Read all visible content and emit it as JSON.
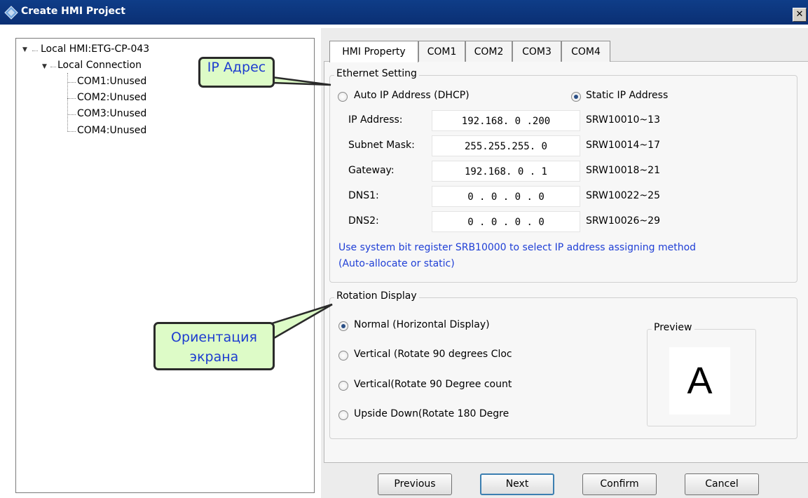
{
  "window": {
    "title": "Create HMI Project",
    "close_glyph": "✕"
  },
  "tree": {
    "root": "Local HMI:ETG-CP-043",
    "connection": "Local Connection",
    "items": [
      "COM1:Unused",
      "COM2:Unused",
      "COM3:Unused",
      "COM4:Unused"
    ]
  },
  "tabs": [
    "HMI Property",
    "COM1",
    "COM2",
    "COM3",
    "COM4"
  ],
  "ethernet": {
    "group_title": "Ethernet Setting",
    "dhcp_label": "Auto IP Address (DHCP)",
    "static_label": "Static IP Address",
    "selected": "static",
    "rows": [
      {
        "label": "IP Address:",
        "value": "192.168. 0 .200",
        "register": "SRW10010~13"
      },
      {
        "label": "Subnet Mask:",
        "value": "255.255.255. 0",
        "register": "SRW10014~17"
      },
      {
        "label": "Gateway:",
        "value": "192.168. 0 . 1",
        "register": "SRW10018~21"
      },
      {
        "label": "DNS1:",
        "value": "0 . 0 . 0 . 0",
        "register": "SRW10022~25"
      },
      {
        "label": "DNS2:",
        "value": "0 . 0 . 0 . 0",
        "register": "SRW10026~29"
      }
    ],
    "note_line1": "Use system bit register SRB10000 to select IP address assigning method",
    "note_line2": "(Auto-allocate or static)"
  },
  "rotation": {
    "group_title": "Rotation Display",
    "options": [
      "Normal (Horizontal Display)",
      "Vertical (Rotate 90 degrees Cloc",
      "Vertical(Rotate 90 Degree count",
      "Upside Down(Rotate 180 Degre"
    ],
    "selected_index": 0,
    "preview_title": "Preview",
    "preview_letter": "A"
  },
  "buttons": {
    "previous": "Previous",
    "next": "Next",
    "confirm": "Confirm",
    "cancel": "Cancel"
  },
  "callouts": {
    "ip": "IP Адрес",
    "orientation_line1": "Ориентация",
    "orientation_line2": "экрана"
  },
  "colors": {
    "title_bar": "#0f3d88",
    "note_text": "#1f3fd6",
    "callout_fill": "#ddfbc7",
    "callout_text": "#1d3cd0"
  }
}
